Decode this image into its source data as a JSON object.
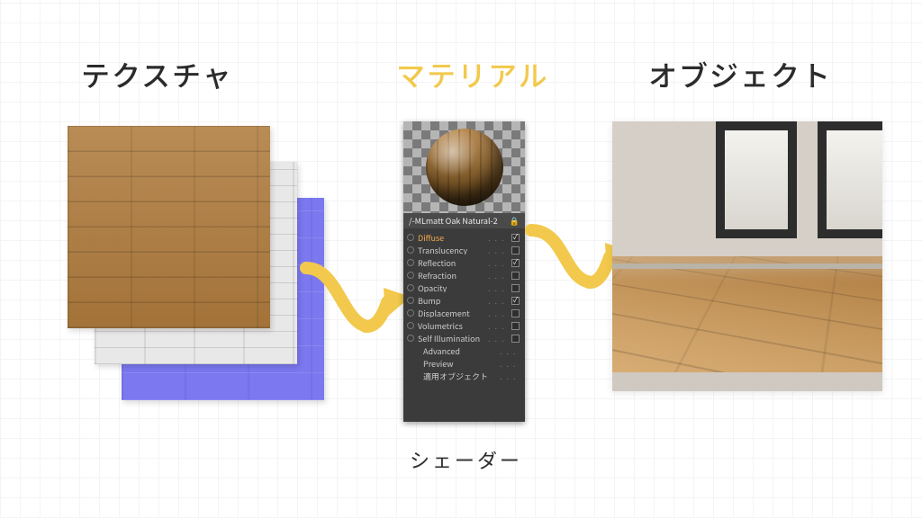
{
  "labels": {
    "texture": "テクスチャ",
    "material": "マテリアル",
    "object": "オブジェクト",
    "shader": "シェーダー"
  },
  "material_name": "/-MLmatt Oak Natural-2",
  "shader_properties": [
    {
      "label": "Diffuse",
      "checked": true,
      "selected": true
    },
    {
      "label": "Translucency",
      "checked": false,
      "selected": false
    },
    {
      "label": "Reflection",
      "checked": true,
      "selected": false
    },
    {
      "label": "Refraction",
      "checked": false,
      "selected": false
    },
    {
      "label": "Opacity",
      "checked": false,
      "selected": false
    },
    {
      "label": "Bump",
      "checked": true,
      "selected": false
    },
    {
      "label": "Displacement",
      "checked": false,
      "selected": false
    },
    {
      "label": "Volumetrics",
      "checked": false,
      "selected": false
    },
    {
      "label": "Self Illumination",
      "checked": false,
      "selected": false
    }
  ],
  "footer_items": [
    "Advanced",
    "Preview",
    "適用オブジェクト"
  ]
}
